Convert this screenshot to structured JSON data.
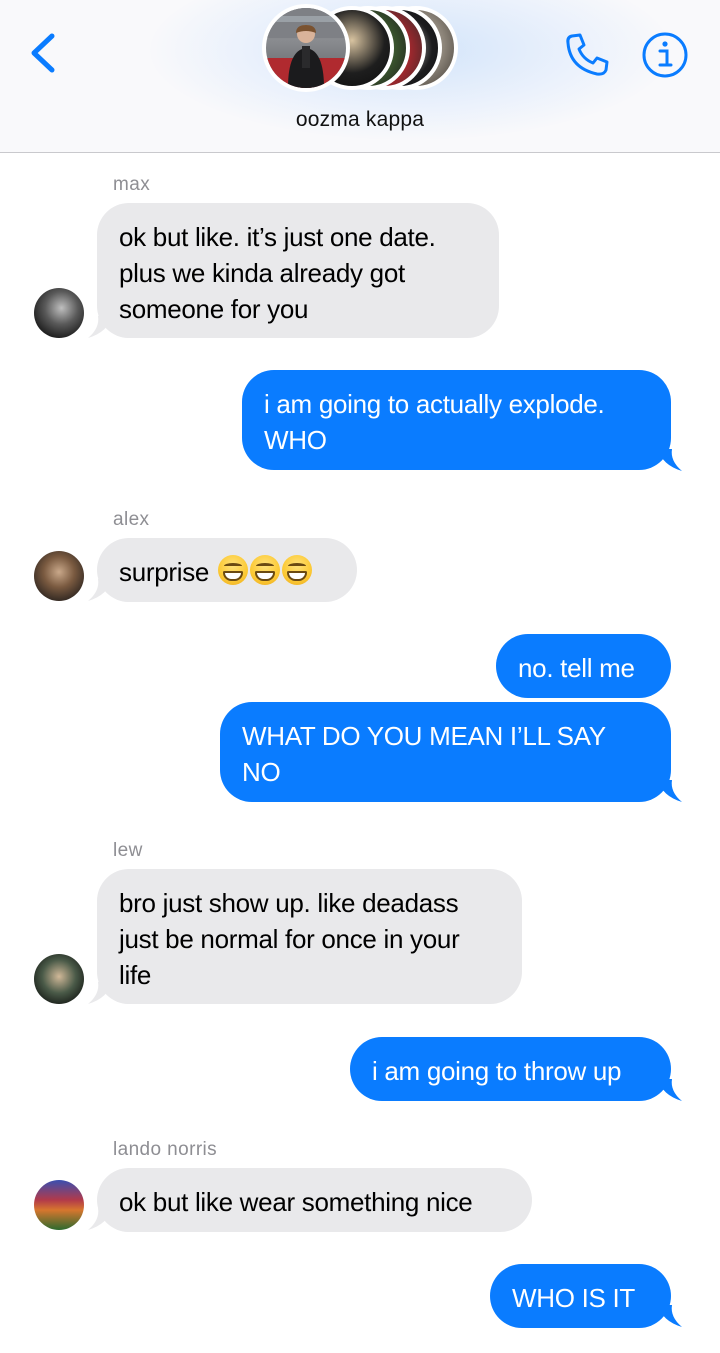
{
  "header": {
    "group_name": "oozma kappa"
  },
  "colors": {
    "accent": "#0a7cff",
    "incoming_bubble": "#e9e9eb",
    "sender_label": "#8e8e93"
  },
  "messages": [
    {
      "direction": "incoming",
      "sender": "max",
      "lines": [
        "ok but like. it’s just one date.",
        "plus we kinda already got",
        "someone for you"
      ]
    },
    {
      "direction": "outgoing",
      "lines": [
        "i am going to actually explode.",
        "WHO"
      ]
    },
    {
      "direction": "incoming",
      "sender": "alex",
      "text": "surprise",
      "emoji": [
        "grinning-face",
        "grinning-face",
        "grinning-face"
      ]
    },
    {
      "direction": "outgoing",
      "text": "no. tell me"
    },
    {
      "direction": "outgoing",
      "lines": [
        "WHAT DO YOU MEAN I’LL SAY",
        "NO"
      ]
    },
    {
      "direction": "incoming",
      "sender": "lew",
      "lines": [
        "bro just show up. like deadass",
        "just be normal for once in your",
        "life"
      ]
    },
    {
      "direction": "outgoing",
      "text": "i am going to throw up"
    },
    {
      "direction": "incoming",
      "sender": "lando norris",
      "text": "ok but like wear something nice"
    },
    {
      "direction": "outgoing",
      "text": "WHO IS IT"
    }
  ],
  "icons": {
    "back": "chevron-left-icon",
    "call": "phone-icon",
    "info": "info-icon"
  }
}
